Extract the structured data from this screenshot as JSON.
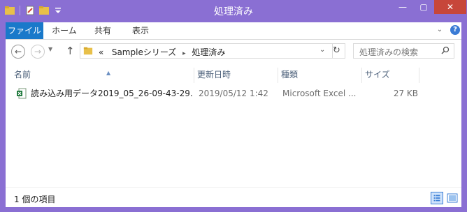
{
  "window": {
    "title": "処理済み",
    "min_glyph": "—",
    "max_glyph": "▢",
    "close_glyph": "✕"
  },
  "ribbon": {
    "tabs": [
      "ファイル",
      "ホーム",
      "共有",
      "表示"
    ],
    "expand_glyph": "⌄",
    "help_glyph": "?"
  },
  "nav": {
    "back_glyph": "←",
    "forward_glyph": "→",
    "recent_glyph": "▼",
    "up_glyph": "↑",
    "refresh_glyph": "↻",
    "address": {
      "prefix": "«",
      "crumbs": [
        "Sampleシリーズ",
        "処理済み"
      ],
      "separator": "▸"
    },
    "dropdown_glyph": "⌄",
    "search_placeholder": "処理済みの検索"
  },
  "columns": {
    "name": "名前",
    "date": "更新日時",
    "type": "種類",
    "size": "サイズ"
  },
  "files": [
    {
      "name": "読み込み用データ2019_05_26-09-43-29...",
      "date": "2019/05/12 1:42",
      "type": "Microsoft Excel ...",
      "size": "27 KB",
      "icon": "excel-file-icon"
    }
  ],
  "status": {
    "text": "1 個の項目"
  },
  "colors": {
    "title_bar": "#8a6fd3",
    "file_tab": "#1979ca",
    "close_button": "#c7463a"
  }
}
